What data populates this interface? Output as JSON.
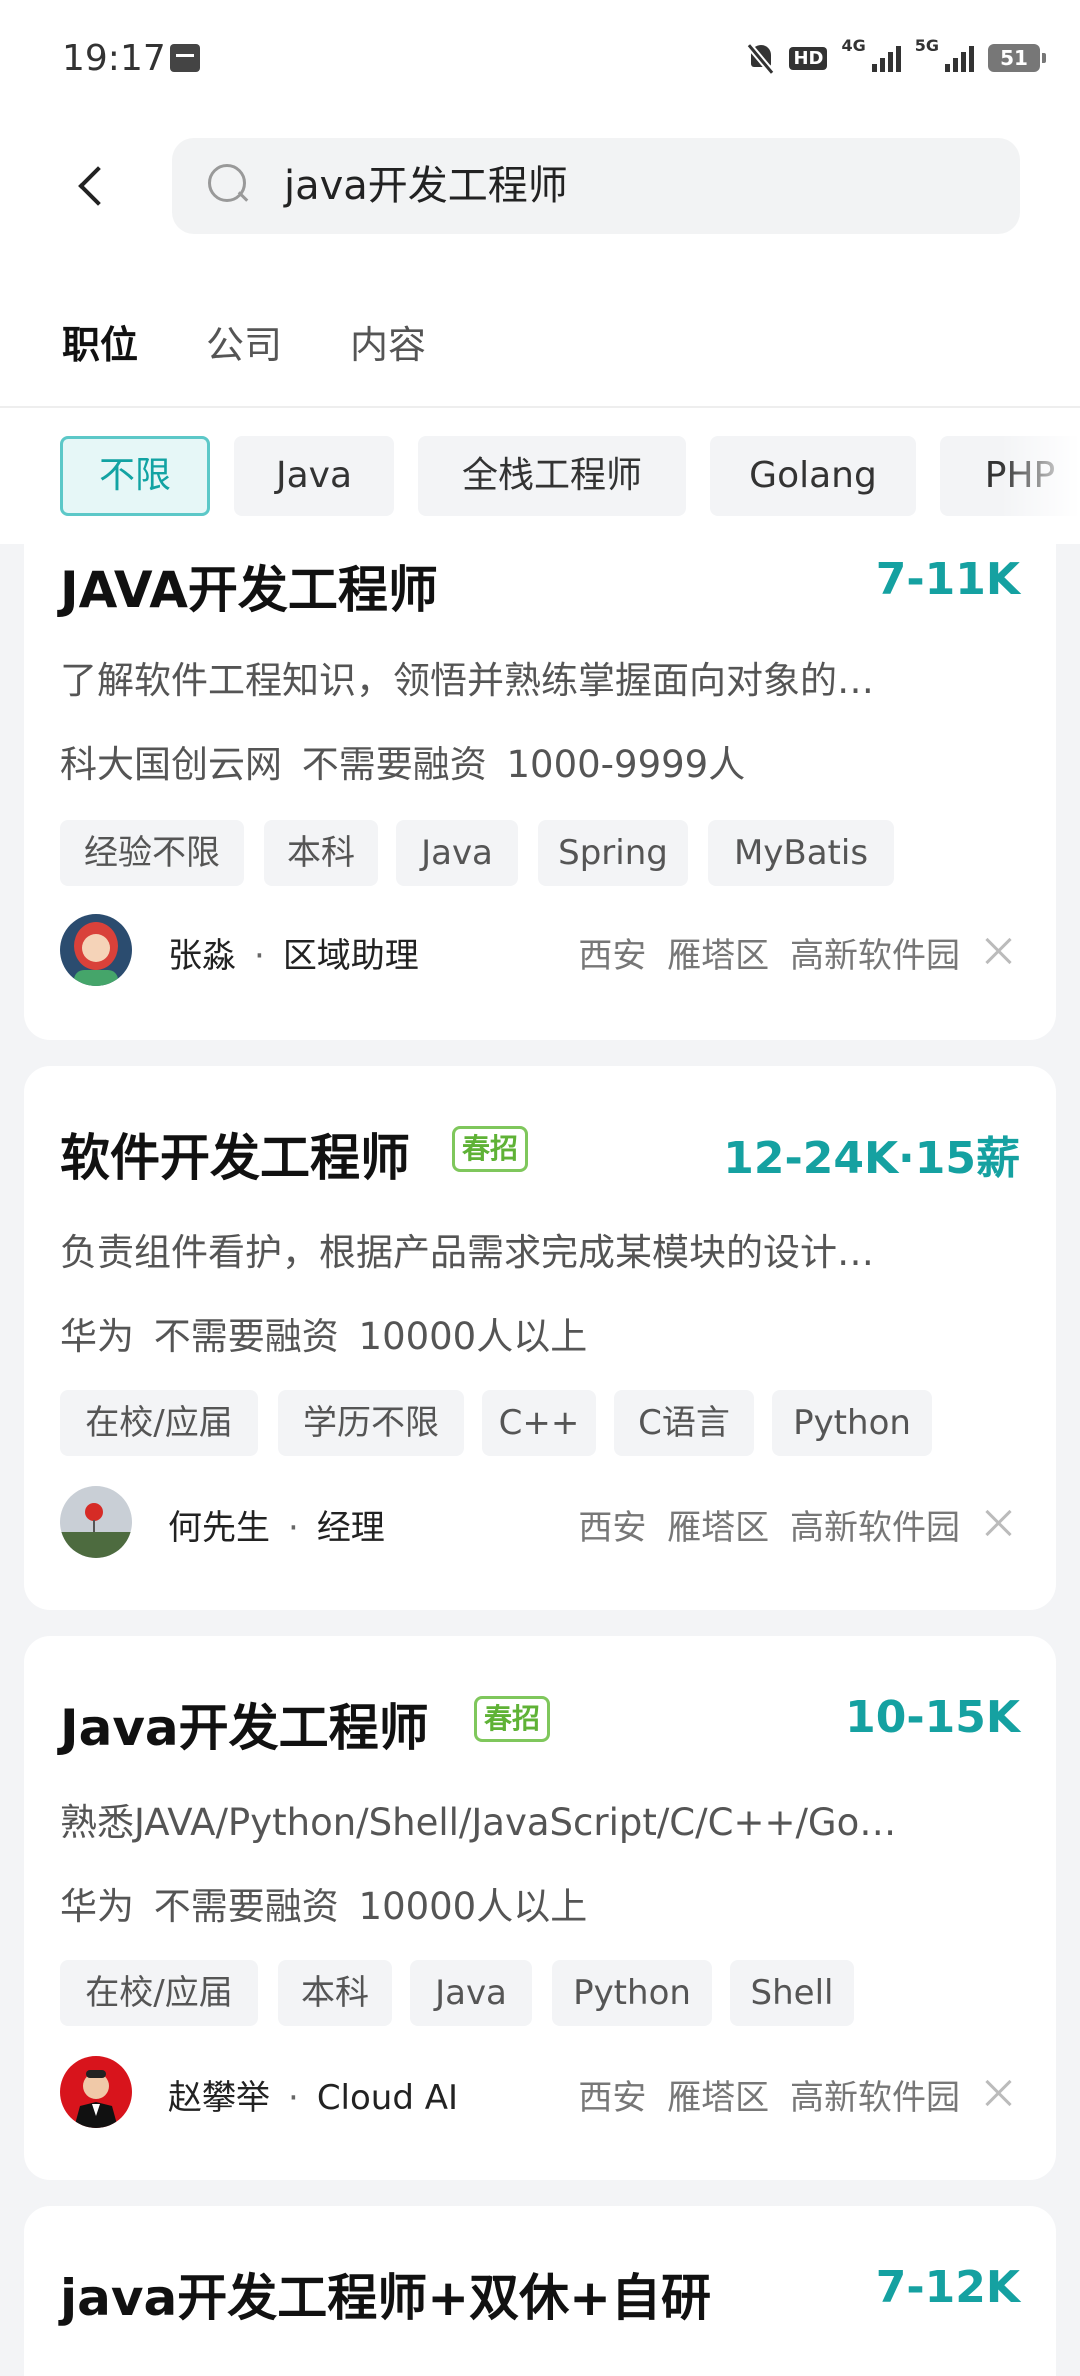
{
  "status_bar": {
    "time": "19:17",
    "battery": "51",
    "network_a": "4G",
    "network_b": "5G",
    "hd": "HD"
  },
  "search": {
    "query": "java开发工程师"
  },
  "tabs": [
    "职位",
    "公司",
    "内容"
  ],
  "filters": [
    "不限",
    "Java",
    "全栈工程师",
    "Golang",
    "PHP"
  ],
  "jobs": [
    {
      "title": "JAVA开发工程师",
      "salary": "7-11K",
      "desc": "了解软件工程知识，领悟并熟练掌握面向对象的…",
      "company": "科大国创云网  不需要融资  1000-9999人",
      "tags": [
        "经验不限",
        "本科",
        "Java",
        "Spring",
        "MyBatis"
      ],
      "recruiter_name": "张淼",
      "recruiter_role": "区域助理",
      "location": "西安  雁塔区  高新软件园"
    },
    {
      "title": "软件开发工程师",
      "badge": "春招",
      "salary": "12-24K·15薪",
      "desc": "负责组件看护，根据产品需求完成某模块的设计…",
      "company": "华为  不需要融资  10000人以上",
      "tags": [
        "在校/应届",
        "学历不限",
        "C++",
        "C语言",
        "Python"
      ],
      "recruiter_name": "何先生",
      "recruiter_role": "经理",
      "location": "西安  雁塔区  高新软件园"
    },
    {
      "title": "Java开发工程师",
      "badge": "春招",
      "salary": "10-15K",
      "desc": "熟悉JAVA/Python/Shell/JavaScript/C/C++/Go…",
      "company": "华为  不需要融资  10000人以上",
      "tags": [
        "在校/应届",
        "本科",
        "Java",
        "Python",
        "Shell"
      ],
      "recruiter_name": "赵攀举",
      "recruiter_role": "Cloud AI",
      "location": "西安  雁塔区  高新软件园"
    },
    {
      "title": "java开发工程师+双休+自研",
      "salary": "7-12K"
    }
  ],
  "colors": {
    "accent": "#15a1a1",
    "badge_green": "#5fb236",
    "chip_active_bg": "#e6f7f7"
  }
}
